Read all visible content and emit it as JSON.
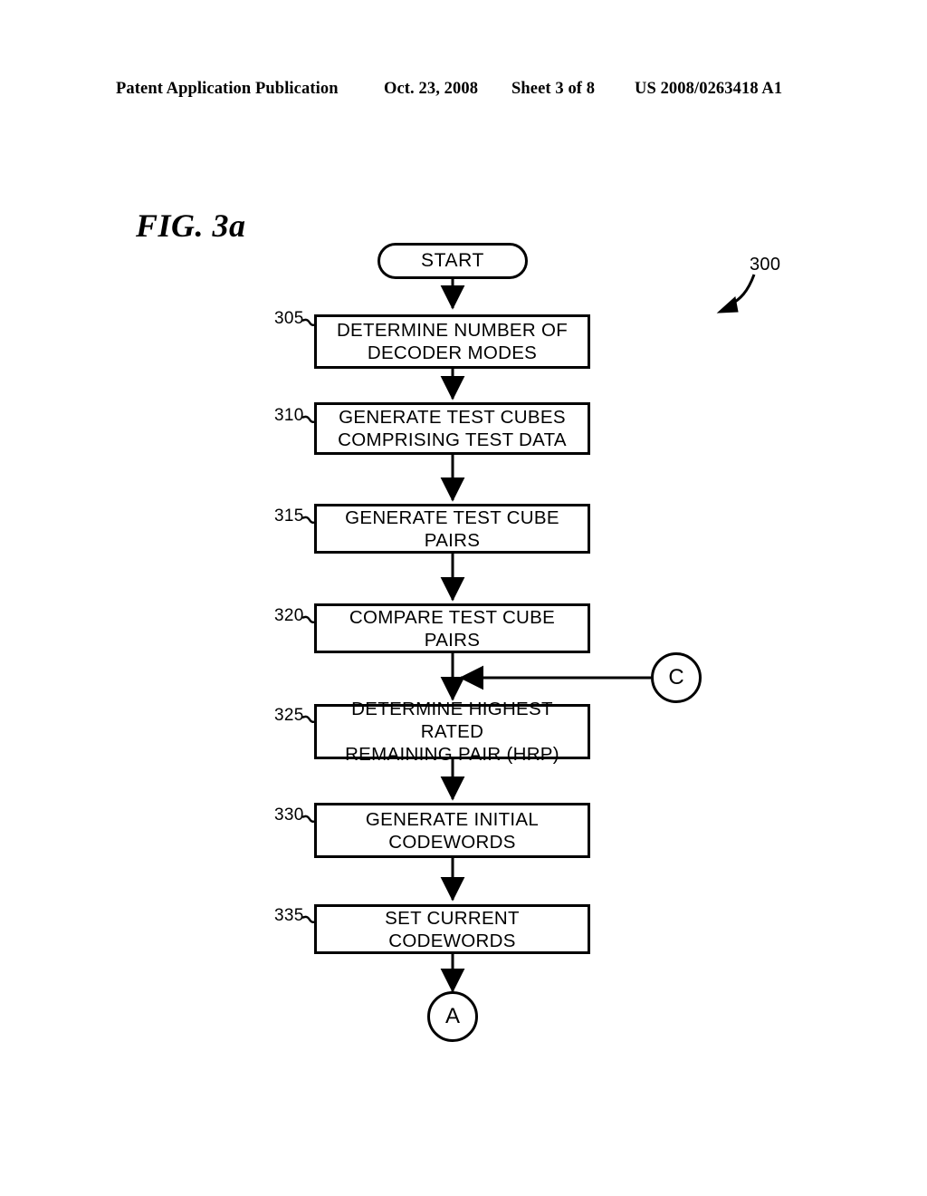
{
  "header": {
    "publication": "Patent Application Publication",
    "date": "Oct. 23, 2008",
    "sheet": "Sheet 3 of 8",
    "patent_number": "US 2008/0263418 A1"
  },
  "figure": {
    "label": "FIG. 3a",
    "diagram_reference": "300"
  },
  "flowchart": {
    "start_node": {
      "label": "START"
    },
    "steps": [
      {
        "ref": "305",
        "label": "DETERMINE NUMBER OF\nDECODER MODES"
      },
      {
        "ref": "310",
        "label": "GENERATE TEST CUBES\nCOMPRISING TEST DATA"
      },
      {
        "ref": "315",
        "label": "GENERATE TEST CUBE PAIRS"
      },
      {
        "ref": "320",
        "label": "COMPARE TEST CUBE PAIRS"
      },
      {
        "ref": "325",
        "label": "DETERMINE HIGHEST RATED\nREMAINING PAIR (HRP)"
      },
      {
        "ref": "330",
        "label": "GENERATE INITIAL\nCODEWORDS"
      },
      {
        "ref": "335",
        "label": "SET CURRENT CODEWORDS"
      }
    ],
    "connectors": [
      {
        "id": "C",
        "label": "C",
        "role": "inbound-offpage-connector"
      },
      {
        "id": "A",
        "label": "A",
        "role": "outbound-offpage-connector"
      }
    ]
  },
  "colors": {
    "ink": "#000000",
    "paper": "#ffffff"
  }
}
